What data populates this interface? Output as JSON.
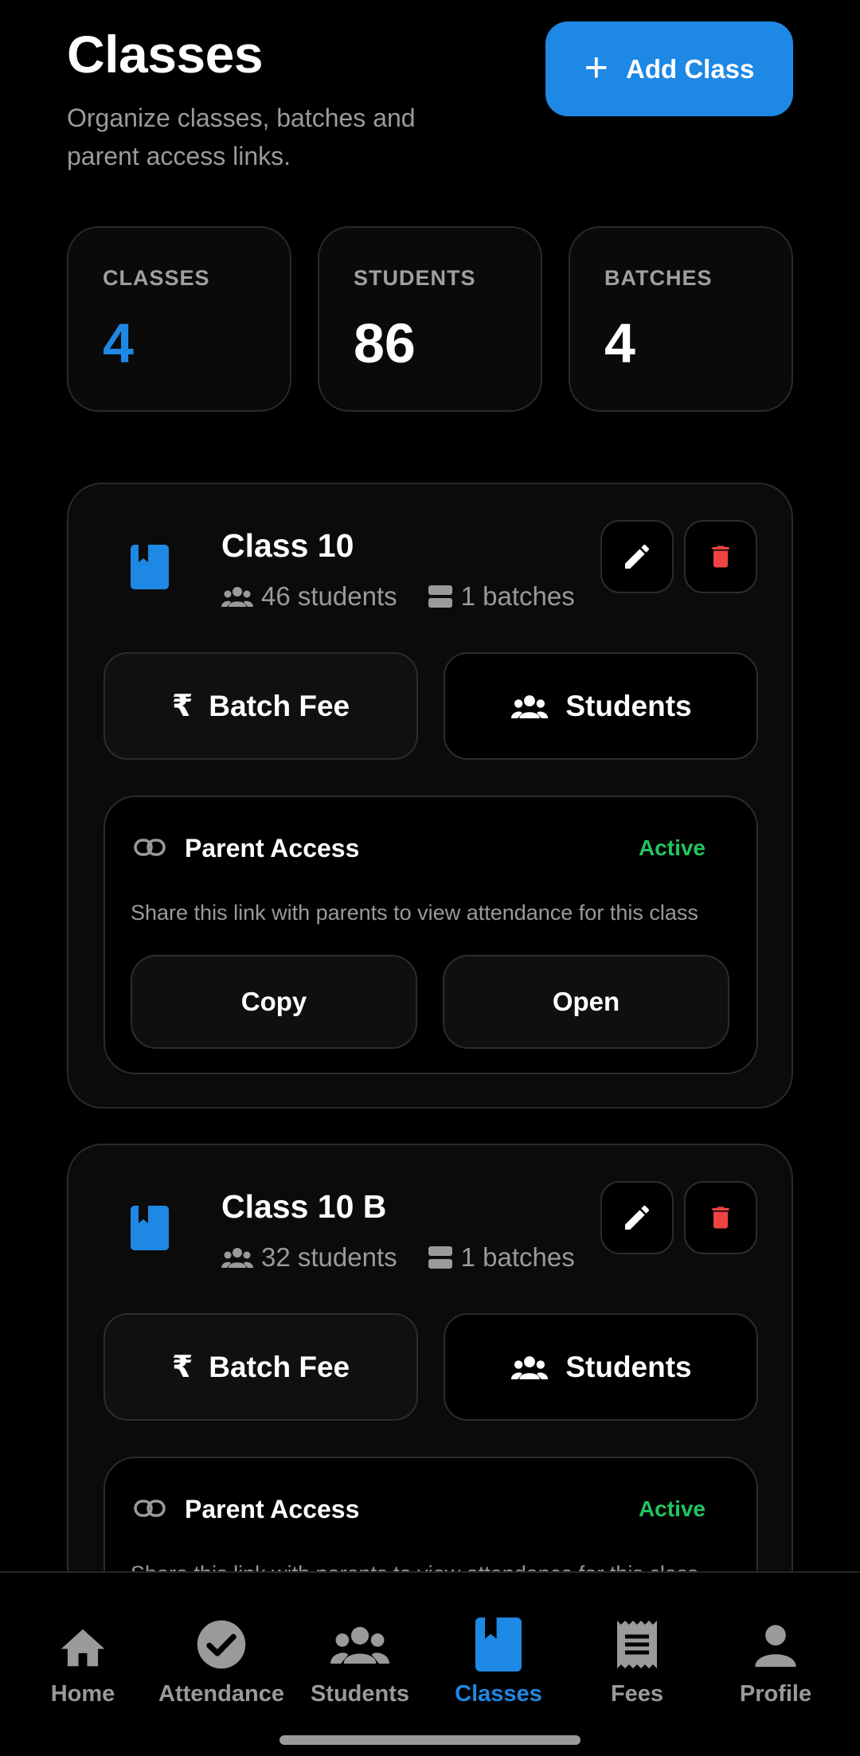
{
  "header": {
    "title": "Classes",
    "subtitle": "Organize classes, batches and parent access links.",
    "add_button_label": "Add Class"
  },
  "stats": [
    {
      "label": "CLASSES",
      "value": "4",
      "color": "#1e88e5"
    },
    {
      "label": "STUDENTS",
      "value": "86",
      "color": "#ffffff"
    },
    {
      "label": "BATCHES",
      "value": "4",
      "color": "#ffffff"
    }
  ],
  "classes": [
    {
      "name": "Class 10",
      "students": "46 students",
      "batches": "1 batches",
      "batch_fee_label": "Batch Fee",
      "students_label": "Students",
      "access": {
        "title": "Parent Access",
        "status": "Active",
        "description": "Share this link with parents to view attendance for this class",
        "copy_label": "Copy",
        "open_label": "Open"
      }
    },
    {
      "name": "Class 10 B",
      "students": "32 students",
      "batches": "1 batches",
      "batch_fee_label": "Batch Fee",
      "students_label": "Students",
      "access": {
        "title": "Parent Access",
        "status": "Active",
        "description": "Share this link with parents to view attendance for this class"
      }
    }
  ],
  "nav": {
    "items": [
      {
        "label": "Home",
        "icon": "home-icon"
      },
      {
        "label": "Attendance",
        "icon": "check-circle-icon"
      },
      {
        "label": "Students",
        "icon": "people-icon"
      },
      {
        "label": "Classes",
        "icon": "book-icon",
        "active": true
      },
      {
        "label": "Fees",
        "icon": "receipt-icon"
      },
      {
        "label": "Profile",
        "icon": "person-icon"
      }
    ]
  },
  "colors": {
    "accent": "#1e88e5",
    "active_status": "#22c55e",
    "delete": "#ef4444"
  }
}
